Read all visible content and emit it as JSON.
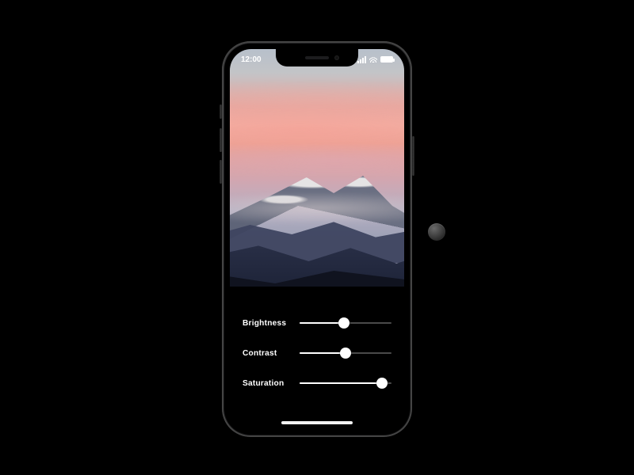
{
  "status_bar": {
    "time": "12:00",
    "battery_pct": 100
  },
  "controls": [
    {
      "label": "Brightness",
      "value": 48
    },
    {
      "label": "Contrast",
      "value": 50
    },
    {
      "label": "Saturation",
      "value": 90
    }
  ]
}
